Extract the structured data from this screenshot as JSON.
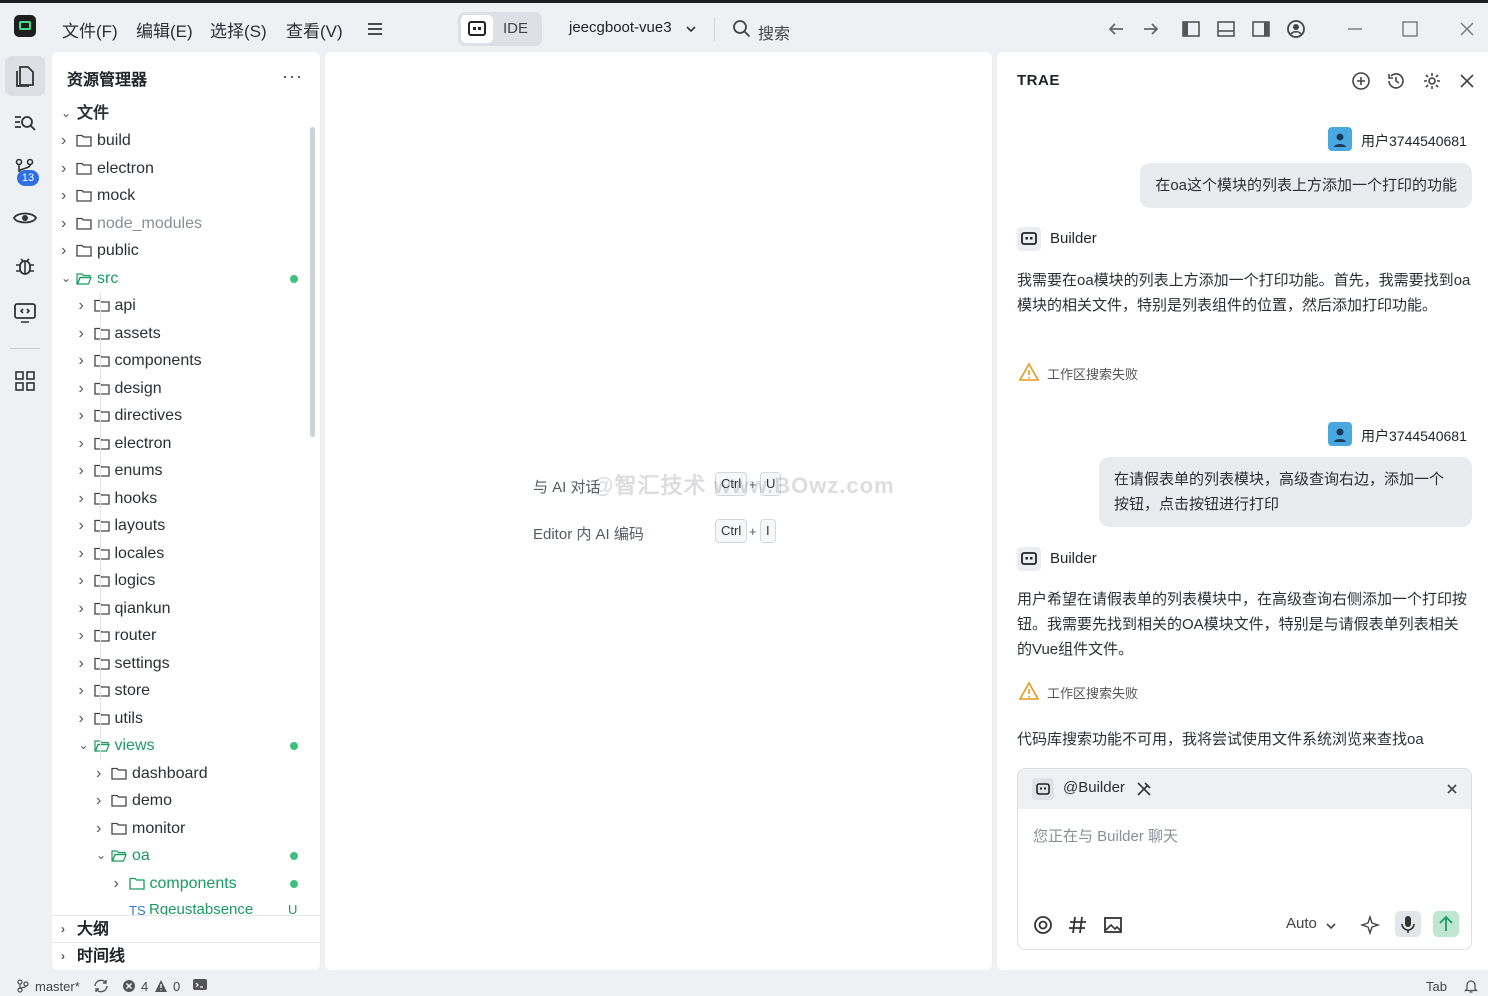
{
  "titlebar": {
    "menus": [
      "文件(F)",
      "编辑(E)",
      "选择(S)",
      "查看(V)"
    ],
    "mode_label": "IDE",
    "project": "jeecgboot-vue3",
    "search_placeholder": "搜索"
  },
  "activity": {
    "scm_badge": "13"
  },
  "explorer": {
    "title": "资源管理器",
    "more": "···",
    "root": "文件",
    "items": [
      {
        "label": "build",
        "depth": 0,
        "open": false,
        "status": ""
      },
      {
        "label": "electron",
        "depth": 0,
        "open": false,
        "status": ""
      },
      {
        "label": "mock",
        "depth": 0,
        "open": false,
        "status": ""
      },
      {
        "label": "node_modules",
        "depth": 0,
        "open": false,
        "status": "ignored"
      },
      {
        "label": "public",
        "depth": 0,
        "open": false,
        "status": ""
      },
      {
        "label": "src",
        "depth": 0,
        "open": true,
        "status": "modified"
      },
      {
        "label": "api",
        "depth": 1,
        "open": false,
        "status": ""
      },
      {
        "label": "assets",
        "depth": 1,
        "open": false,
        "status": ""
      },
      {
        "label": "components",
        "depth": 1,
        "open": false,
        "status": ""
      },
      {
        "label": "design",
        "depth": 1,
        "open": false,
        "status": ""
      },
      {
        "label": "directives",
        "depth": 1,
        "open": false,
        "status": ""
      },
      {
        "label": "electron",
        "depth": 1,
        "open": false,
        "status": ""
      },
      {
        "label": "enums",
        "depth": 1,
        "open": false,
        "status": ""
      },
      {
        "label": "hooks",
        "depth": 1,
        "open": false,
        "status": ""
      },
      {
        "label": "layouts",
        "depth": 1,
        "open": false,
        "status": ""
      },
      {
        "label": "locales",
        "depth": 1,
        "open": false,
        "status": ""
      },
      {
        "label": "logics",
        "depth": 1,
        "open": false,
        "status": ""
      },
      {
        "label": "qiankun",
        "depth": 1,
        "open": false,
        "status": ""
      },
      {
        "label": "router",
        "depth": 1,
        "open": false,
        "status": ""
      },
      {
        "label": "settings",
        "depth": 1,
        "open": false,
        "status": ""
      },
      {
        "label": "store",
        "depth": 1,
        "open": false,
        "status": ""
      },
      {
        "label": "utils",
        "depth": 1,
        "open": false,
        "status": ""
      },
      {
        "label": "views",
        "depth": 1,
        "open": true,
        "status": "modified"
      },
      {
        "label": "dashboard",
        "depth": 2,
        "open": false,
        "status": ""
      },
      {
        "label": "demo",
        "depth": 2,
        "open": false,
        "status": ""
      },
      {
        "label": "monitor",
        "depth": 2,
        "open": false,
        "status": ""
      },
      {
        "label": "oa",
        "depth": 2,
        "open": true,
        "status": "modified"
      },
      {
        "label": "components",
        "depth": 3,
        "open": false,
        "status": "modified"
      }
    ],
    "partial_file": {
      "prefix": "TS",
      "label": "Rqeustabsence",
      "mark": "U"
    },
    "outline": "大纲",
    "timeline": "时间线"
  },
  "editor": {
    "hint1": "与 AI 对话",
    "hint1_keys": [
      "Ctrl",
      "U"
    ],
    "hint2": "Editor 内 AI 编码",
    "hint2_keys": [
      "Ctrl",
      "I"
    ],
    "plus": "+",
    "watermark": "@智汇技术 www.BOwz.com"
  },
  "chat": {
    "title": "TRAE",
    "messages": [
      {
        "role": "user",
        "user": "用户3744540681",
        "text": "在oa这个模块的列表上方添加一个打印的功能"
      },
      {
        "role": "bot",
        "bot": "Builder",
        "text": "我需要在oa模块的列表上方添加一个打印功能。首先，我需要找到oa模块的相关文件，特别是列表组件的位置，然后添加打印功能。",
        "warn": "工作区搜索失败"
      },
      {
        "role": "user",
        "user": "用户3744540681",
        "text": "在请假表单的列表模块，高级查询右边，添加一个按钮，点击按钮进行打印"
      },
      {
        "role": "bot",
        "bot": "Builder",
        "text": "用户希望在请假表单的列表模块中，在高级查询右侧添加一个打印按钮。我需要先找到相关的OA模块文件，特别是与请假表单列表相关的Vue组件文件。",
        "warn": "工作区搜索失败",
        "trail": "代码库搜索功能不可用，我将尝试使用文件系统浏览来查找oa"
      }
    ],
    "composer": {
      "mention": "@Builder",
      "placeholder": "您正在与 Builder 聊天",
      "model": "Auto"
    }
  },
  "status": {
    "branch": "master*",
    "errors": "4",
    "warnings": "0",
    "tab": "Tab"
  },
  "colors": {
    "accent": "#3fbf7f",
    "brand": "#1e1e1e",
    "badge": "#2f6fe4"
  }
}
